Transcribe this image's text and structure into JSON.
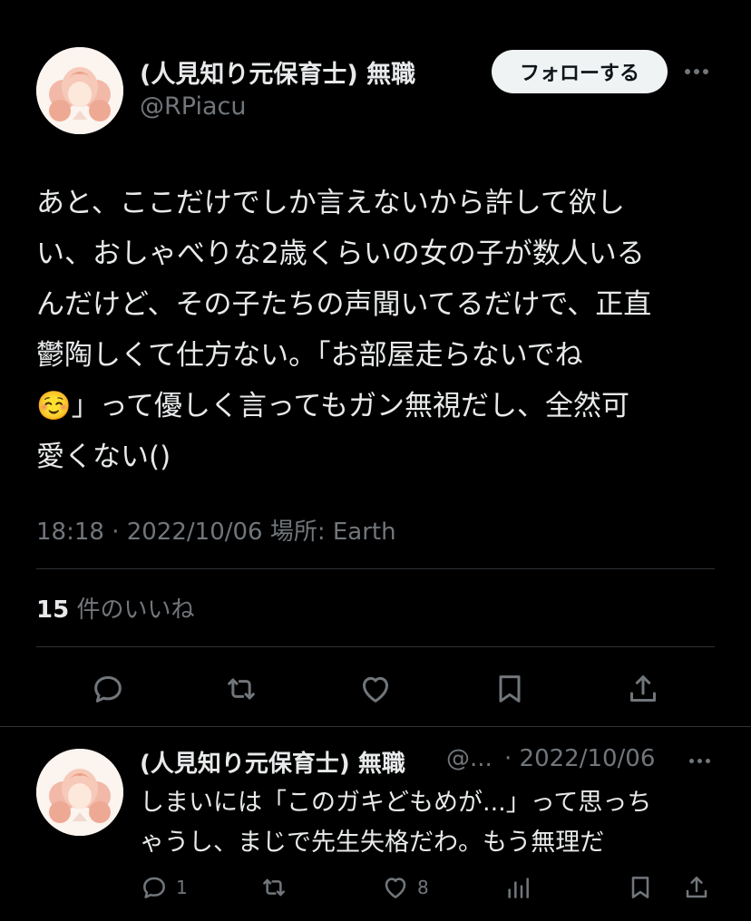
{
  "tweet": {
    "display_name": "(人見知り元保育士) 無職",
    "handle": "@RPiacu",
    "follow_label": "フォローする",
    "text_lines": [
      "あと、ここだけでしか言えないから許して欲し",
      "い、おしゃべりな2歳くらいの女の子が数人いる",
      "んだけど、その子たちの声聞いてるだけで、正直",
      "鬱陶しくて仕方ない。「お部屋走らないでね",
      "☺️」って優しく言ってもガン無視だし、全然可",
      "愛くない()"
    ],
    "meta": "18:18 · 2022/10/06 場所: Earth",
    "likes_count": "15",
    "likes_label": "件のいいね"
  },
  "reply": {
    "display_name": "(人見知り元保育士) 無職",
    "handle_truncated": "@...",
    "date": "· 2022/10/06",
    "text_lines": [
      "しまいには「このガキどもめが...」って思っち",
      "ゃうし、まじで先生失格だわ。もう無理だ"
    ],
    "reply_count": "1",
    "like_count": "8"
  },
  "icons": {
    "reply": "reply-icon",
    "retweet": "retweet-icon",
    "like": "heart-icon",
    "bookmark": "bookmark-icon",
    "share": "share-icon",
    "views": "analytics-icon",
    "more": "more-icon"
  },
  "colors": {
    "background": "#000000",
    "text": "#e7e9ea",
    "secondary": "#71767b",
    "divider": "#2f3336",
    "follow_bg": "#eff3f4"
  }
}
